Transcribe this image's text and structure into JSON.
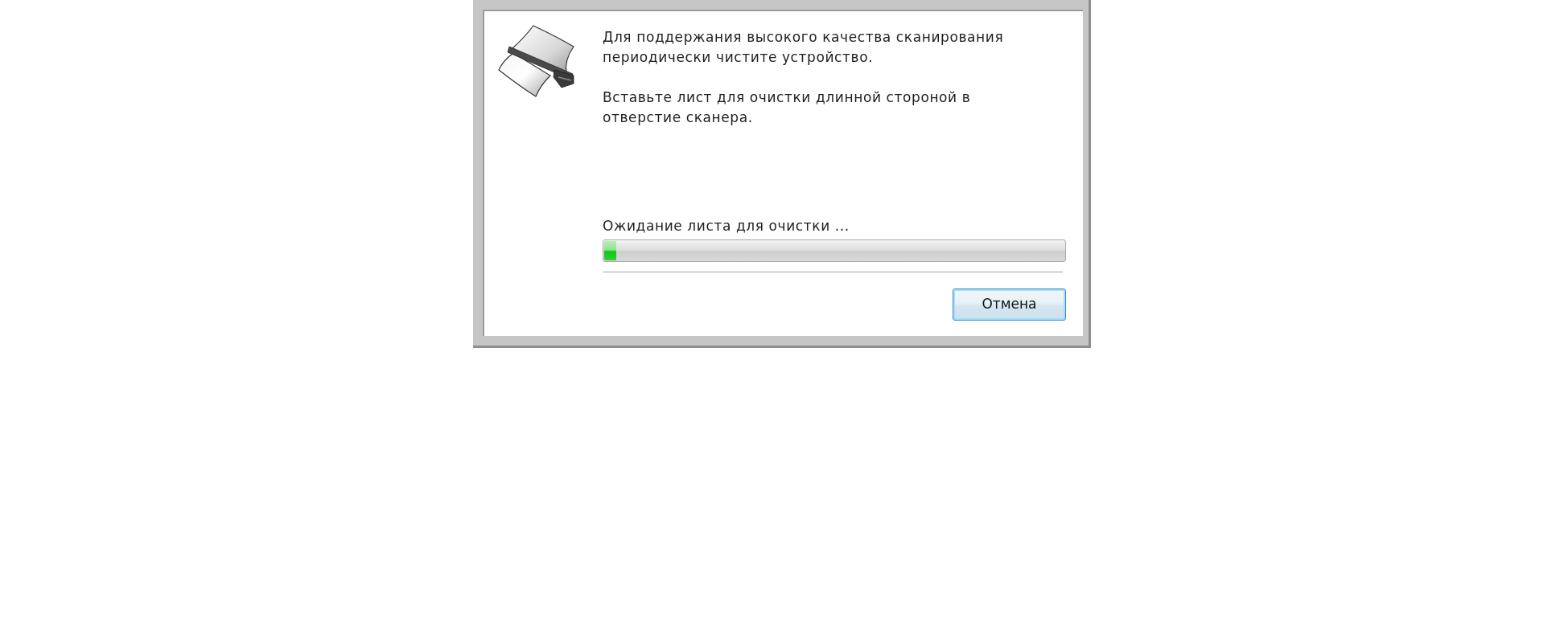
{
  "message": [
    "Для поддержания высокого качества сканирования периодически чистите устройство.",
    "Вставьте лист для очистки длинной стороной в отверстие сканера."
  ],
  "progress": {
    "label": "Ожидание листа для очистки ...",
    "level": 0.026
  },
  "buttons": [
    {
      "label": "Отмена",
      "default": true
    }
  ]
}
